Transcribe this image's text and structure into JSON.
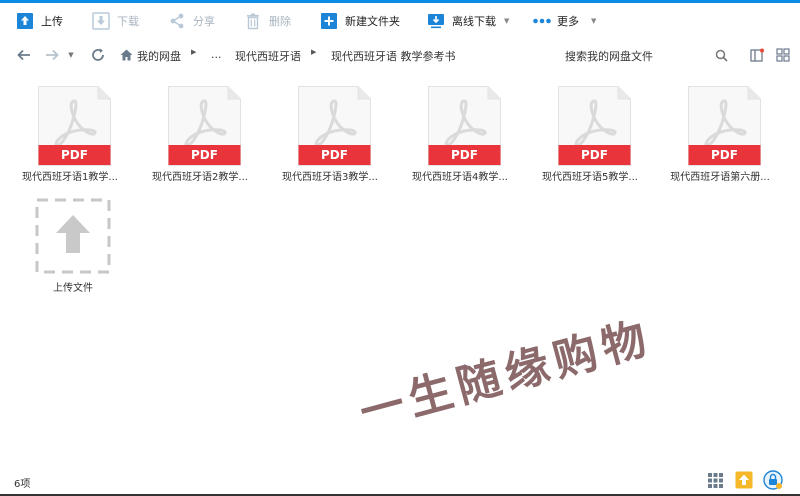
{
  "toolbar": {
    "upload_label": "上传",
    "download_label": "下载",
    "share_label": "分享",
    "delete_label": "删除",
    "new_folder_label": "新建文件夹",
    "offline_download_label": "离线下载",
    "more_label": "更多"
  },
  "breadcrumb": {
    "root": "我的网盘",
    "ellipsis": "...",
    "parent": "现代西班牙语",
    "current": "现代西班牙语 教学参考书"
  },
  "search": {
    "placeholder": "搜索我的网盘文件"
  },
  "files": [
    {
      "name": "现代西班牙语1教学...",
      "type_badge": "PDF"
    },
    {
      "name": "现代西班牙语2教学...",
      "type_badge": "PDF"
    },
    {
      "name": "现代西班牙语3教学...",
      "type_badge": "PDF"
    },
    {
      "name": "现代西班牙语4教学...",
      "type_badge": "PDF"
    },
    {
      "name": "现代西班牙语5教学...",
      "type_badge": "PDF"
    },
    {
      "name": "现代西班牙语第六册...",
      "type_badge": "PDF"
    }
  ],
  "upload_tile": {
    "label": "上传文件"
  },
  "watermark": "一生随缘购物",
  "status": {
    "count": "6项"
  },
  "colors": {
    "accent": "#0a8de6",
    "pdf_red": "#e8343a",
    "watermark": "#8c6a6c"
  }
}
